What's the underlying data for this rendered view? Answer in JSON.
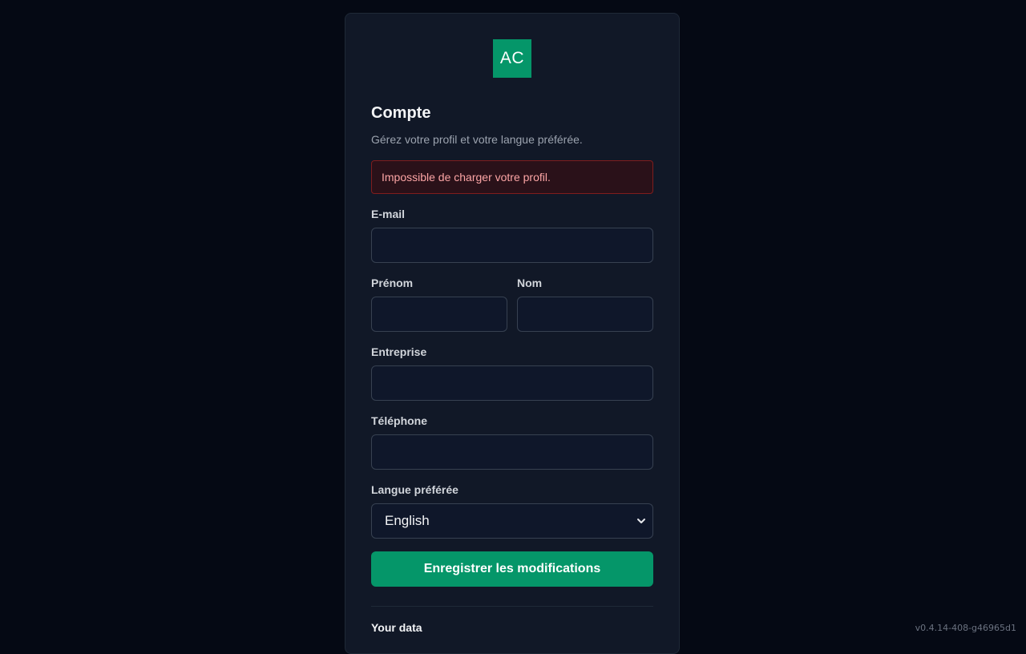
{
  "logo": {
    "text": "AC",
    "color": "#059669"
  },
  "page": {
    "title": "Compte",
    "subtitle": "Gérez votre profil et votre langue préférée."
  },
  "error": {
    "message": "Impossible de charger votre profil."
  },
  "form": {
    "email": {
      "label": "E-mail",
      "value": ""
    },
    "first_name": {
      "label": "Prénom",
      "value": ""
    },
    "last_name": {
      "label": "Nom",
      "value": ""
    },
    "company": {
      "label": "Entreprise",
      "value": ""
    },
    "phone": {
      "label": "Téléphone",
      "value": ""
    },
    "language": {
      "label": "Langue préférée",
      "selected": "English",
      "icon": "chevron-down-icon"
    },
    "save_label": "Enregistrer les modifications"
  },
  "data_section": {
    "title": "Your data"
  },
  "version": "v0.4.14-408-g46965d1",
  "colors": {
    "background": "#050914",
    "card": "#111827",
    "accent": "#059669",
    "error_text": "#fca5a5",
    "error_border": "#7f1d1d"
  }
}
